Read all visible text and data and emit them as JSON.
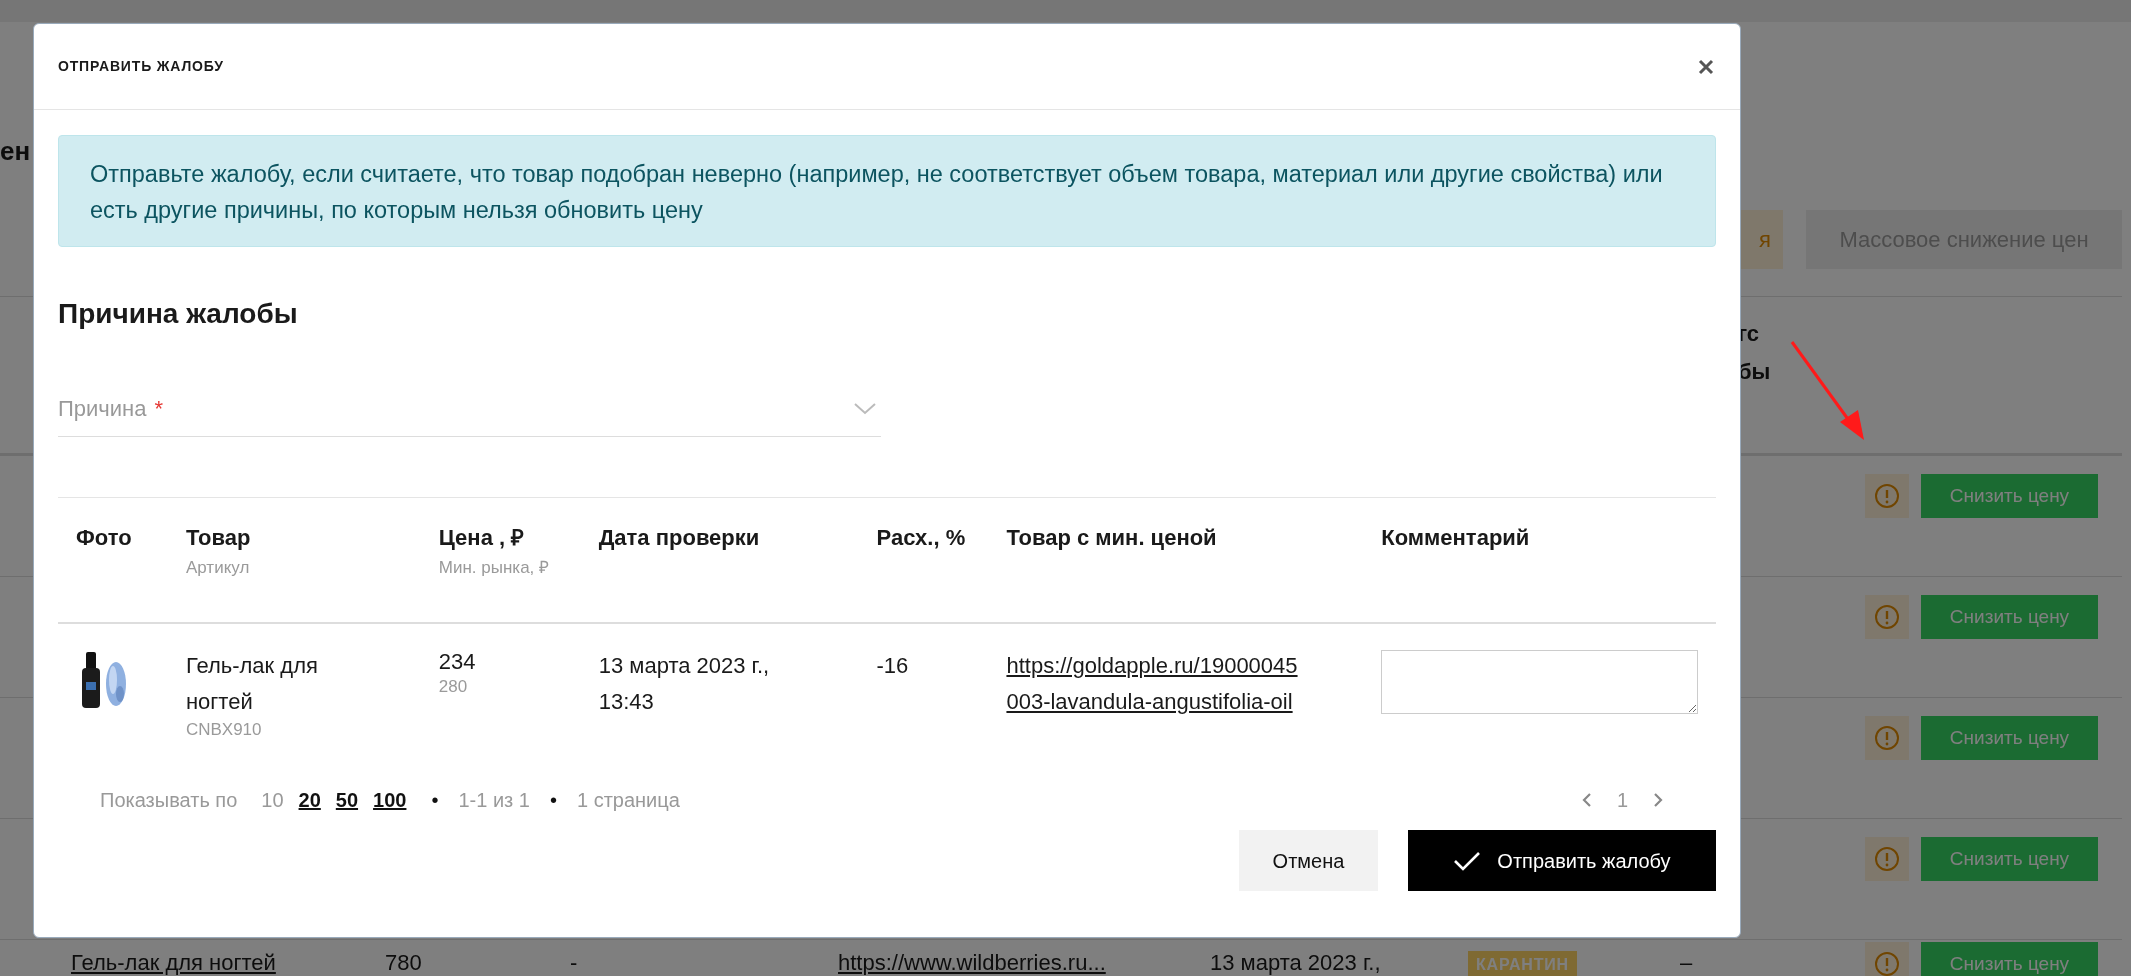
{
  "background": {
    "title_fragment": "ен",
    "toolbar": [
      {
        "label": "я",
        "kind": "warning"
      },
      {
        "label": "Массовое снижение цен",
        "kind": "disabled"
      }
    ],
    "header_fragments": [
      "гс",
      "бы"
    ],
    "rows": [
      {
        "action": "Снизить цену"
      },
      {
        "action": "Снизить цену"
      },
      {
        "action": "Снизить цену"
      },
      {
        "action": "Снизить цену"
      }
    ],
    "last_row": {
      "product": "Гель-лак для ногтей",
      "price": "780",
      "min_price": "-",
      "link": "https://www.wildberries.ru...",
      "date": "13 марта 2023 г.,",
      "status": "КАРАНТИН",
      "complaint": "–",
      "action": "Снизить цену"
    }
  },
  "modal": {
    "title": "ОТПРАВИТЬ ЖАЛОБУ",
    "alert": "Отправьте жалобу, если считаете, что товар подобран неверно (например, не соответствует объем товара, материал или другие свойства) или есть другие причины, по которым нельзя обновить цену",
    "section_title": "Причина жалобы",
    "reason_field": {
      "placeholder": "Причина",
      "required_mark": "*"
    },
    "table": {
      "columns": [
        {
          "title": "Фото"
        },
        {
          "title": "Товар",
          "subtitle": "Артикул"
        },
        {
          "title": "Цена , ₽",
          "subtitle": "Мин. рынка, ₽"
        },
        {
          "title": "Дата проверки"
        },
        {
          "title": "Расх., %"
        },
        {
          "title": "Товар с мин. ценой"
        },
        {
          "title": "Комментарий"
        }
      ],
      "rows": [
        {
          "product": "Гель-лак для ногтей",
          "sku": "CNBX910",
          "price": "234",
          "min_price": "280",
          "date": "13 марта 2023 г., 13:43",
          "diff": "-16",
          "link": "https://goldapple.ru/19000045003-lavandula-angustifolia-oil"
        }
      ]
    },
    "pagination": {
      "label": "Показывать по",
      "sizes": [
        {
          "label": "10",
          "selected": true
        },
        {
          "label": "20",
          "selected": false
        },
        {
          "label": "50",
          "selected": false
        },
        {
          "label": "100",
          "selected": false
        }
      ],
      "separator_1": "•",
      "range": "1-1 из 1",
      "separator_2": "•",
      "pages_text": "1 страница",
      "page": "1"
    },
    "buttons": [
      {
        "label": "Отмена",
        "kind": "secondary"
      },
      {
        "label": "Отправить жалобу",
        "kind": "primary"
      }
    ]
  }
}
